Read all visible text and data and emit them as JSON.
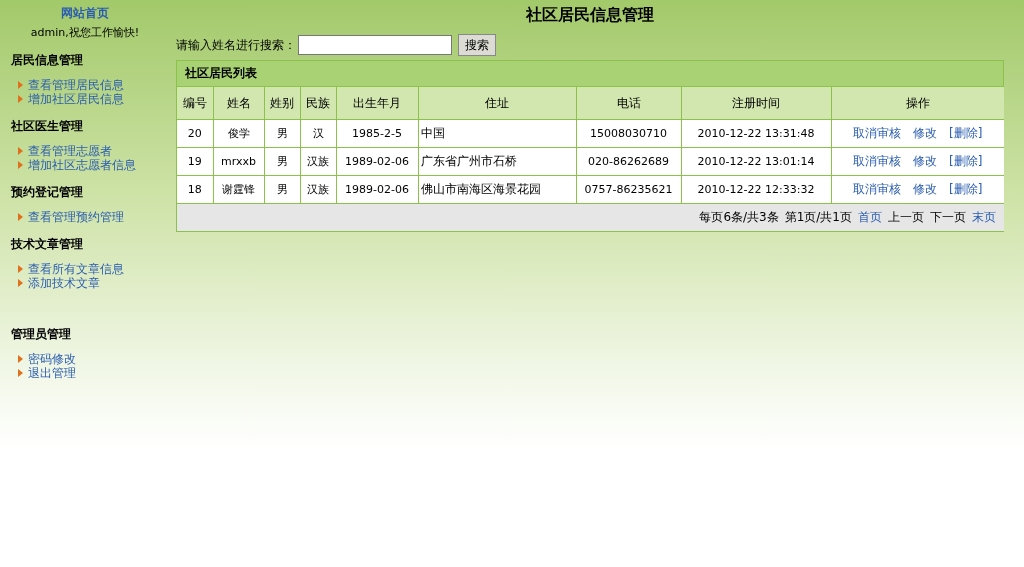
{
  "sidebar": {
    "home_link": "网站首页",
    "greeting": "admin,祝您工作愉快!",
    "sections": [
      {
        "title": "居民信息管理",
        "links": [
          "查看管理居民信息",
          "增加社区居民信息"
        ]
      },
      {
        "title": "社区医生管理",
        "links": [
          "查看管理志愿者",
          "增加社区志愿者信息"
        ]
      },
      {
        "title": "预约登记管理",
        "links": [
          "查看管理预约管理"
        ]
      },
      {
        "title": "技术文章管理",
        "links": [
          "查看所有文章信息",
          "添加技术文章"
        ]
      },
      {
        "title": "管理员管理",
        "links": [
          "密码修改",
          "退出管理"
        ]
      }
    ]
  },
  "page_title": "社区居民信息管理",
  "search": {
    "label": "请输入姓名进行搜索：",
    "button": "搜索"
  },
  "table": {
    "title": "社区居民列表",
    "columns": [
      "编号",
      "姓名",
      "姓别",
      "民族",
      "出生年月",
      "住址",
      "电话",
      "注册时间",
      "操作"
    ],
    "rows": [
      {
        "cells": [
          "20",
          "俊学",
          "男",
          "汉",
          "1985-2-5",
          "中国",
          "15008030710",
          "2010-12-22 13:31:48"
        ],
        "actions": [
          "取消审核",
          "修改",
          "[删除]"
        ]
      },
      {
        "cells": [
          "19",
          "mrxxb",
          "男",
          "汉族",
          "1989-02-06",
          "广东省广州市石桥",
          "020-86262689",
          "2010-12-22 13:01:14"
        ],
        "actions": [
          "取消审核",
          "修改",
          "[删除]"
        ]
      },
      {
        "cells": [
          "18",
          "谢霆锋",
          "男",
          "汉族",
          "1989-02-06",
          "佛山市南海区海景花园",
          "0757-86235621",
          "2010-12-22 12:33:32"
        ],
        "actions": [
          "取消审核",
          "修改",
          "[删除]"
        ]
      }
    ],
    "pager": [
      {
        "label": "每页6条/共3条",
        "kind": "text"
      },
      {
        "label": "第1页/共1页",
        "kind": "text"
      },
      {
        "label": "首页",
        "kind": "link"
      },
      {
        "label": "上一页",
        "kind": "text"
      },
      {
        "label": "下一页",
        "kind": "text"
      },
      {
        "label": "末页",
        "kind": "link"
      }
    ]
  }
}
